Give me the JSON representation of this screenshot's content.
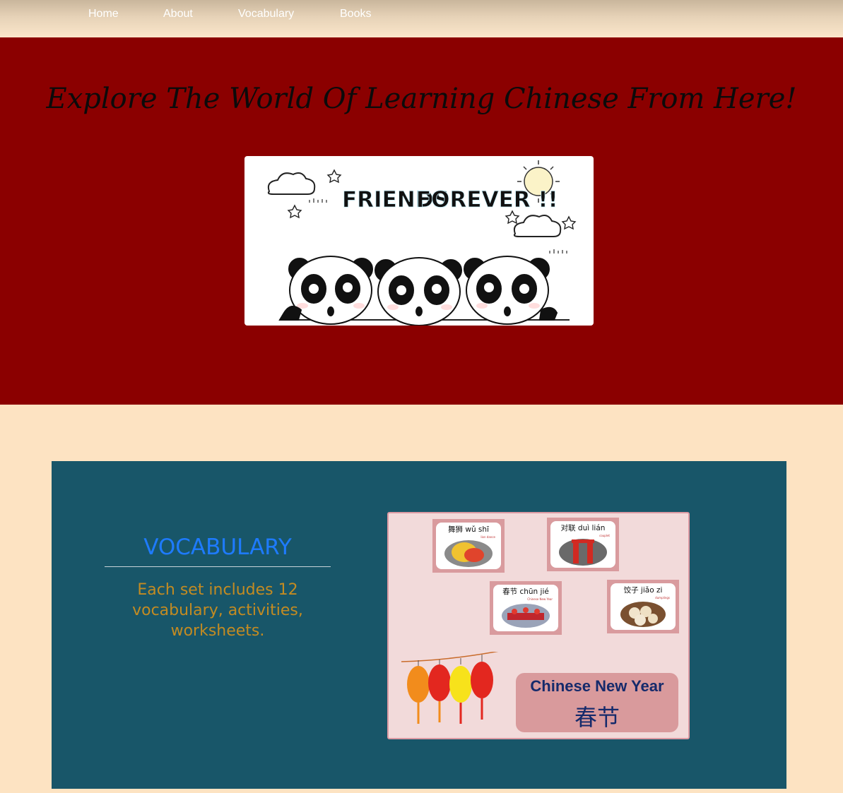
{
  "nav": {
    "items": [
      "Home",
      "About",
      "Vocabulary",
      "Books"
    ]
  },
  "hero": {
    "heading": "Explore The World Of Learning Chinese From Here!",
    "banner_text": "FRIENDS FOREVER !!"
  },
  "vocab": {
    "title": "VOCABULARY",
    "description": "Each set includes 12 vocabulary, activities, worksheets.",
    "poster": {
      "cards": [
        {
          "label": "舞狮  wǔ shī",
          "sub": "lion dance"
        },
        {
          "label": "对联  duì lián",
          "sub": "couplet"
        },
        {
          "label": "春节  chūn jié",
          "sub": "Chinese New Year"
        },
        {
          "label": "饺子  jiǎo zi",
          "sub": "dumplings"
        }
      ],
      "title_en": "Chinese New Year",
      "title_zh": "春节"
    }
  },
  "colors": {
    "page_bg": "#fde3c2",
    "hero_bg": "#8b0000",
    "vocab_bg": "#185669",
    "vocab_title": "#1e7bff",
    "vocab_desc": "#c38b22"
  }
}
